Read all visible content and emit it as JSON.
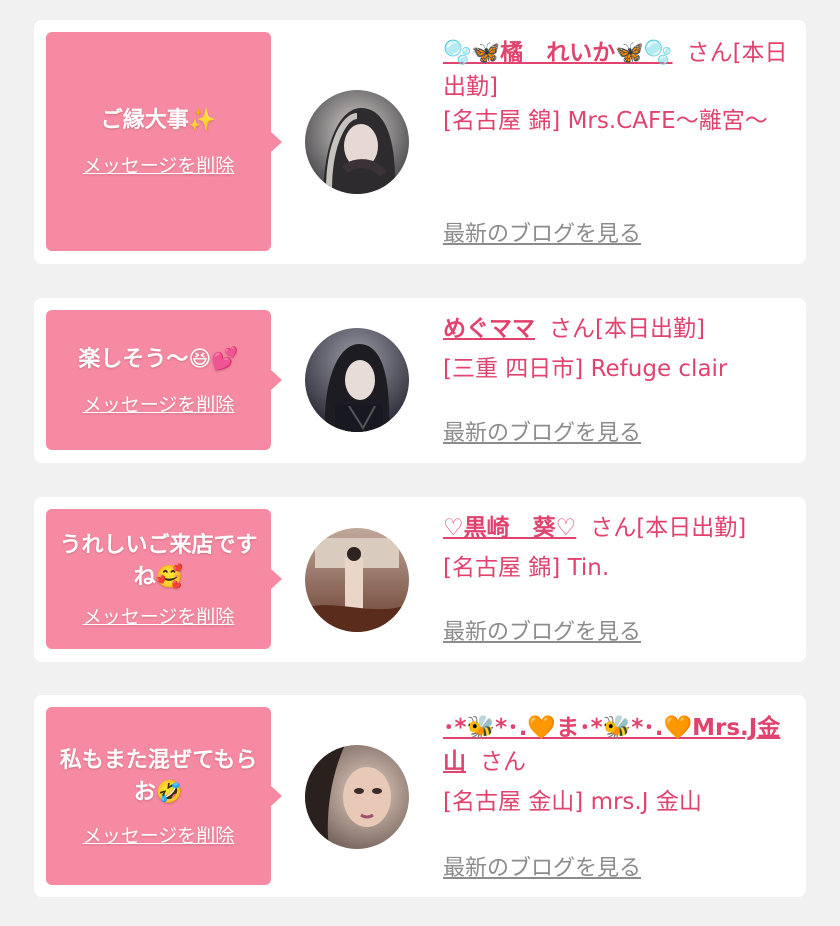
{
  "common": {
    "delete_label": "メッセージを削除",
    "blog_label": "最新のブログを見る",
    "san": "さん"
  },
  "entries": [
    {
      "message": "ご縁大事✨",
      "name": "🫧🦋橘　れいか🦋🫧",
      "status": "[本日出勤]",
      "shop": "[名古屋 錦] Mrs.CAFE〜離宮〜"
    },
    {
      "message": "楽しそう〜😆💕",
      "name": "めぐママ",
      "status": "[本日出勤]",
      "shop": "[三重 四日市] Refuge clair"
    },
    {
      "message": "うれしいご来店ですね🥰",
      "name": "♡黒崎　葵♡",
      "status": "[本日出勤]",
      "shop": "[名古屋 錦] Tin."
    },
    {
      "message": "私もまた混ぜてもらお🤣",
      "name": "･*🐝*･.🧡ま･*🐝*･.🧡Mrs.J金山",
      "status": "",
      "shop": "[名古屋 金山] mrs.J 金山"
    }
  ],
  "colors": {
    "page_bg": "#f1f1f1",
    "card_bg": "#ffffff",
    "bubble_bg": "#f68aa2",
    "accent_text": "#e0436e",
    "link_gray": "#8c8c8c"
  }
}
